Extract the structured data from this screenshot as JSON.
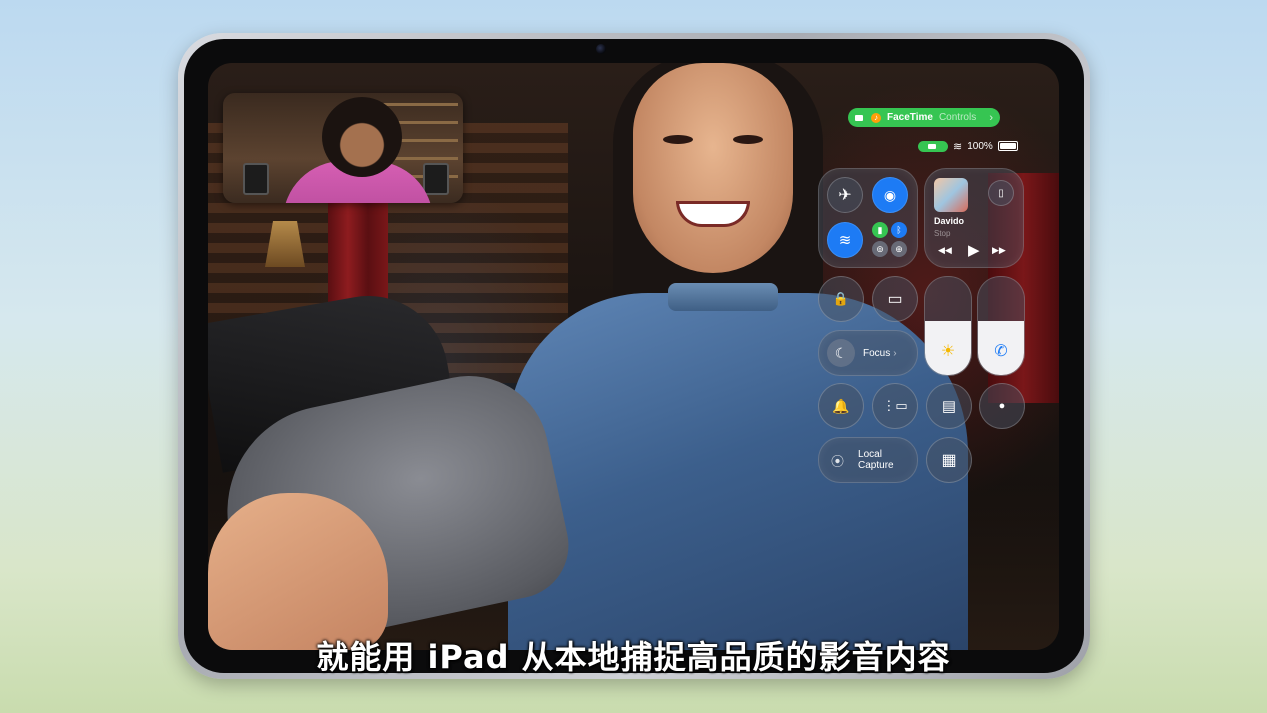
{
  "facetime_pill": {
    "app_label": "FaceTime",
    "controls_label": "Controls",
    "chevron": "›",
    "mic_glyph": "♪"
  },
  "status_bar": {
    "battery_text": "100%",
    "wifi_glyph": "≋"
  },
  "control_center": {
    "airplane_glyph": "✈",
    "airdrop_glyph": "◉",
    "wifi_glyph": "≋",
    "cellular_glyph": "▮",
    "bluetooth_glyph": "ᛒ",
    "link_glyph": "⊚",
    "hotspot_glyph": "⊕",
    "music": {
      "title": "Davido",
      "subtitle": "Stop",
      "prev": "◀◀",
      "play": "▶",
      "next": "▶▶",
      "remote_glyph": "▯"
    },
    "lock_glyph": "🔒",
    "screen_mirror_glyph": "▭",
    "focus_glyph": "☾",
    "focus_label": "Focus",
    "focus_chevron": "›",
    "brightness": {
      "level_percent": 55,
      "icon": "☀"
    },
    "volume": {
      "level_percent": 55,
      "icon": "✆"
    },
    "bell_glyph": "🔔",
    "stage_manager_glyph": "⋮▭",
    "note_glyph": "▤",
    "record_glyph": "●",
    "local_capture": {
      "line1": "Local",
      "line2": "Capture",
      "icon": "⦿"
    },
    "calculator_glyph": "▦"
  },
  "subtitle": "就能用 iPad 从本地捕捉高品质的影音内容",
  "colors": {
    "accent_blue": "#1d7bf5",
    "facetime_green": "#36c552",
    "mic_orange": "#ff9f0a"
  }
}
